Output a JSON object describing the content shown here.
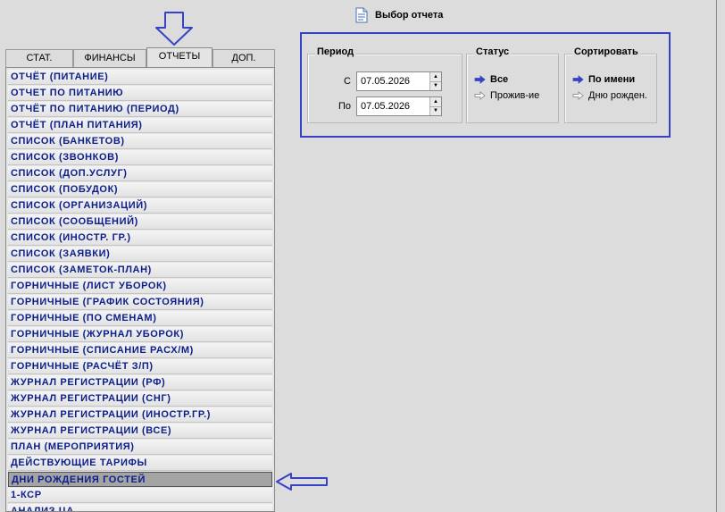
{
  "header": {
    "title": "Выбор отчета",
    "icon": "report-document-icon"
  },
  "tabs": [
    {
      "label": "СТАТ.",
      "active": false
    },
    {
      "label": "ФИНАНСЫ",
      "active": false
    },
    {
      "label": "ОТЧЕТЫ",
      "active": true
    },
    {
      "label": "ДОП.",
      "active": false
    }
  ],
  "reports": [
    "ОТЧЁТ (ПИТАНИЕ)",
    "ОТЧЕТ ПО ПИТАНИЮ",
    "ОТЧЁТ ПО ПИТАНИЮ (ПЕРИОД)",
    "ОТЧЁТ (ПЛАН ПИТАНИЯ)",
    "СПИСОК (БАНКЕТОВ)",
    "СПИСОК (ЗВОНКОВ)",
    "СПИСОК (ДОП.УСЛУГ)",
    "СПИСОК (ПОБУДОК)",
    "СПИСОК (ОРГАНИЗАЦИЙ)",
    "СПИСОК (СООБЩЕНИЙ)",
    "СПИСОК (ИНОСТР. ГР.)",
    "СПИСОК (ЗАЯВКИ)",
    "СПИСОК (ЗАМЕТОК-ПЛАН)",
    "ГОРНИЧНЫЕ (ЛИСТ УБОРОК)",
    "ГОРНИЧНЫЕ (ГРАФИК СОСТОЯНИЯ)",
    "ГОРНИЧНЫЕ (ПО СМЕНАМ)",
    "ГОРНИЧНЫЕ (ЖУРНАЛ УБОРОК)",
    "ГОРНИЧНЫЕ (СПИСАНИЕ РАСХ/М)",
    "ГОРНИЧНЫЕ (РАСЧЁТ З/П)",
    "ЖУРНАЛ РЕГИСТРАЦИИ (РФ)",
    "ЖУРНАЛ РЕГИСТРАЦИИ (СНГ)",
    "ЖУРНАЛ РЕГИСТРАЦИИ (ИНОСТР.ГР.)",
    "ЖУРНАЛ РЕГИСТРАЦИИ (ВСЕ)",
    "ПЛАН (МЕРОПРИЯТИЯ)",
    "ДЕЙСТВУЮЩИЕ ТАРИФЫ",
    "ДНИ РОЖДЕНИЯ ГОСТЕЙ",
    "1-КСР",
    "АНАЛИЗ ЦА"
  ],
  "selected_report_index": 25,
  "period": {
    "legend": "Период",
    "from_label": "С",
    "from_value": "07.05.2026",
    "to_label": "По",
    "to_value": "07.05.2026"
  },
  "status": {
    "legend": "Статус",
    "options": [
      "Все",
      "Прожив-ие"
    ],
    "selected_index": 0
  },
  "sort": {
    "legend": "Сортировать",
    "options": [
      "По имени",
      "Дню рожден."
    ],
    "selected_index": 0
  },
  "colors": {
    "annotation_blue": "#3842c8",
    "list_text": "#0b1e8a",
    "selected_row": "#a4a4a4",
    "background": "#dcdcdc"
  }
}
